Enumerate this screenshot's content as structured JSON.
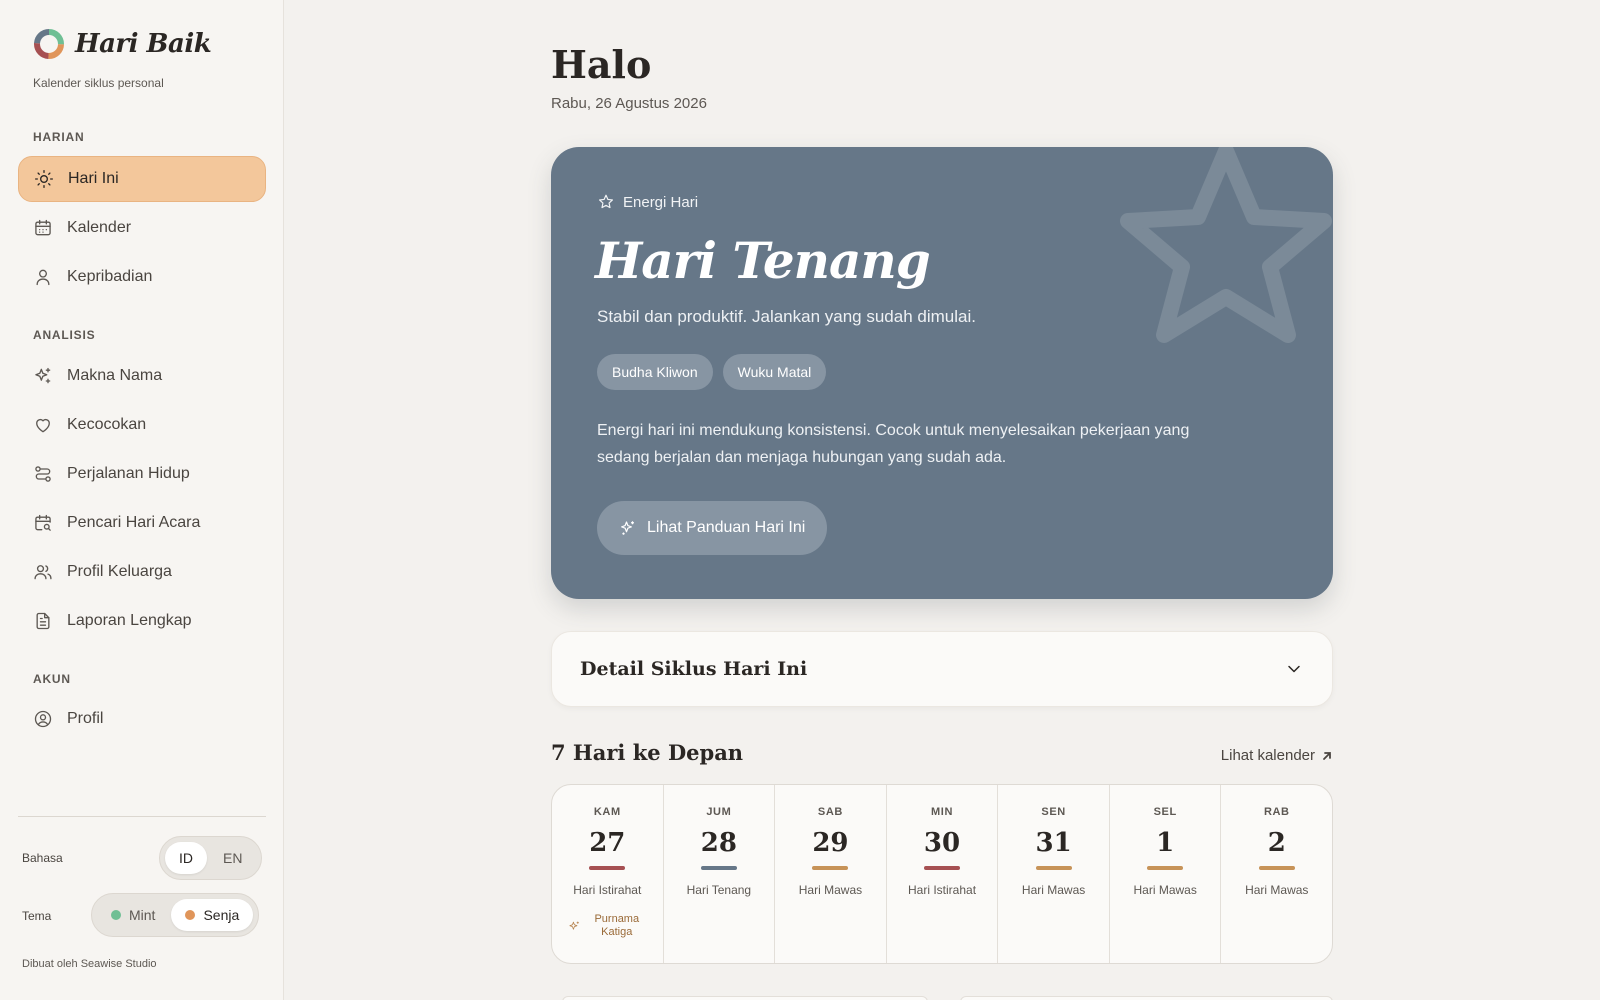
{
  "brand": {
    "name": "Hari Baik",
    "subtitle": "Kalender siklus personal"
  },
  "nav": {
    "sections": [
      {
        "title": "HARIAN",
        "items": [
          {
            "label": "Hari Ini",
            "icon": "sun-icon",
            "active": true
          },
          {
            "label": "Kalender",
            "icon": "calendar-icon"
          },
          {
            "label": "Kepribadian",
            "icon": "user-icon"
          }
        ]
      },
      {
        "title": "ANALISIS",
        "items": [
          {
            "label": "Makna Nama",
            "icon": "sparkles-icon"
          },
          {
            "label": "Kecocokan",
            "icon": "heart-icon"
          },
          {
            "label": "Perjalanan Hidup",
            "icon": "route-icon"
          },
          {
            "label": "Pencari Hari Acara",
            "icon": "calendar-search-icon"
          },
          {
            "label": "Profil Keluarga",
            "icon": "users-icon"
          },
          {
            "label": "Laporan Lengkap",
            "icon": "document-icon"
          }
        ]
      },
      {
        "title": "AKUN",
        "items": [
          {
            "label": "Profil",
            "icon": "user-circle-icon"
          }
        ]
      }
    ]
  },
  "preferences": {
    "language": {
      "label": "Bahasa",
      "options": [
        "ID",
        "EN"
      ],
      "selected": "ID"
    },
    "theme": {
      "label": "Tema",
      "options": [
        {
          "label": "Mint",
          "color": "#6fbf94"
        },
        {
          "label": "Senja",
          "color": "#e0955a"
        }
      ],
      "selected": "Senja"
    }
  },
  "credit": "Dibuat oleh Seawise Studio",
  "header": {
    "greeting": "Halo",
    "date": "Rabu, 26 Agustus 2026"
  },
  "hero": {
    "kicker": "Energi Hari",
    "title": "Hari Tenang",
    "subtitle": "Stabil dan produktif. Jalankan yang sudah dimulai.",
    "chips": [
      "Budha Kliwon",
      "Wuku Matal"
    ],
    "body": "Energi hari ini mendukung konsistensi. Cocok untuk menyelesaikan pekerjaan yang sedang berjalan dan menjaga hubungan yang sudah ada.",
    "button": "Lihat Panduan Hari Ini",
    "color": "#667788"
  },
  "detail": {
    "title": "Detail Siklus Hari Ini"
  },
  "week": {
    "title": "7 Hari ke Depan",
    "link": "Lihat kalender",
    "days": [
      {
        "name": "KAM",
        "num": "27",
        "label": "Hari Istirahat",
        "color": "#a65052",
        "event": "Purnama Katiga"
      },
      {
        "name": "JUM",
        "num": "28",
        "label": "Hari Tenang",
        "color": "#667788"
      },
      {
        "name": "SAB",
        "num": "29",
        "label": "Hari Mawas",
        "color": "#c79358"
      },
      {
        "name": "MIN",
        "num": "30",
        "label": "Hari Istirahat",
        "color": "#a65052"
      },
      {
        "name": "SEN",
        "num": "31",
        "label": "Hari Mawas",
        "color": "#c79358"
      },
      {
        "name": "SEL",
        "num": "1",
        "label": "Hari Mawas",
        "color": "#c79358"
      },
      {
        "name": "RAB",
        "num": "2",
        "label": "Hari Mawas",
        "color": "#c79358"
      }
    ]
  }
}
